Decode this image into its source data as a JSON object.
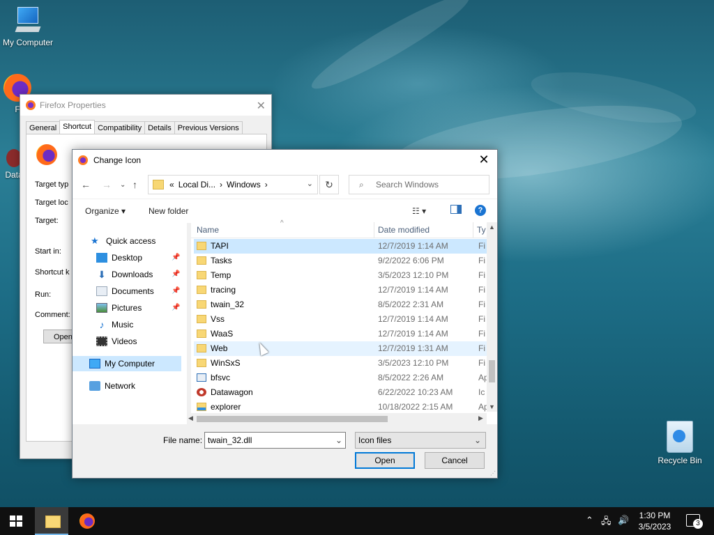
{
  "desktop": {
    "icons": [
      {
        "label": "My Computer"
      },
      {
        "label": "F"
      },
      {
        "label": "Data"
      },
      {
        "label": "Recycle Bin"
      }
    ]
  },
  "properties_window": {
    "title": "Firefox Properties",
    "tabs": [
      "General",
      "Shortcut",
      "Compatibility",
      "Details",
      "Previous Versions"
    ],
    "active_tab": "Shortcut",
    "labels": [
      "Target typ",
      "Target loc",
      "Target:",
      "Start in:",
      "Shortcut k",
      "Run:",
      "Comment:"
    ],
    "open_button": "Open"
  },
  "dialog": {
    "title": "Change Icon",
    "breadcrumb": [
      "«",
      "Local Di...",
      "›",
      "Windows",
      "›"
    ],
    "search_placeholder": "Search Windows",
    "organize": "Organize ▾",
    "new_folder": "New folder",
    "nav_pane": {
      "quick_access": "Quick access",
      "items": [
        "Desktop",
        "Downloads",
        "Documents",
        "Pictures",
        "Music",
        "Videos"
      ],
      "my_computer": "My Computer",
      "network": "Network"
    },
    "columns": {
      "name": "Name",
      "date": "Date modified",
      "type": "Ty"
    },
    "files": [
      {
        "name": "TAPI",
        "date": "12/7/2019 1:14 AM",
        "type": "Fi"
      },
      {
        "name": "Tasks",
        "date": "9/2/2022 6:06 PM",
        "type": "Fi"
      },
      {
        "name": "Temp",
        "date": "3/5/2023 12:10 PM",
        "type": "Fi"
      },
      {
        "name": "tracing",
        "date": "12/7/2019 1:14 AM",
        "type": "Fi"
      },
      {
        "name": "twain_32",
        "date": "8/5/2022 2:31 AM",
        "type": "Fi"
      },
      {
        "name": "Vss",
        "date": "12/7/2019 1:14 AM",
        "type": "Fi"
      },
      {
        "name": "WaaS",
        "date": "12/7/2019 1:14 AM",
        "type": "Fi"
      },
      {
        "name": "Web",
        "date": "12/7/2019 1:31 AM",
        "type": "Fi"
      },
      {
        "name": "WinSxS",
        "date": "3/5/2023 12:10 PM",
        "type": "Fi"
      },
      {
        "name": "bfsvc",
        "date": "8/5/2022 2:26 AM",
        "type": "Ap"
      },
      {
        "name": "Datawagon",
        "date": "6/22/2022 10:23 AM",
        "type": "Ic"
      },
      {
        "name": "explorer",
        "date": "10/18/2022 2:15 AM",
        "type": "Ap"
      }
    ],
    "file_name_label": "File name:",
    "file_name_value": "twain_32.dll",
    "file_type": "Icon files",
    "open_button": "Open",
    "cancel_button": "Cancel"
  },
  "taskbar": {
    "time": "1:30 PM",
    "date": "3/5/2023",
    "notification_count": "3"
  }
}
